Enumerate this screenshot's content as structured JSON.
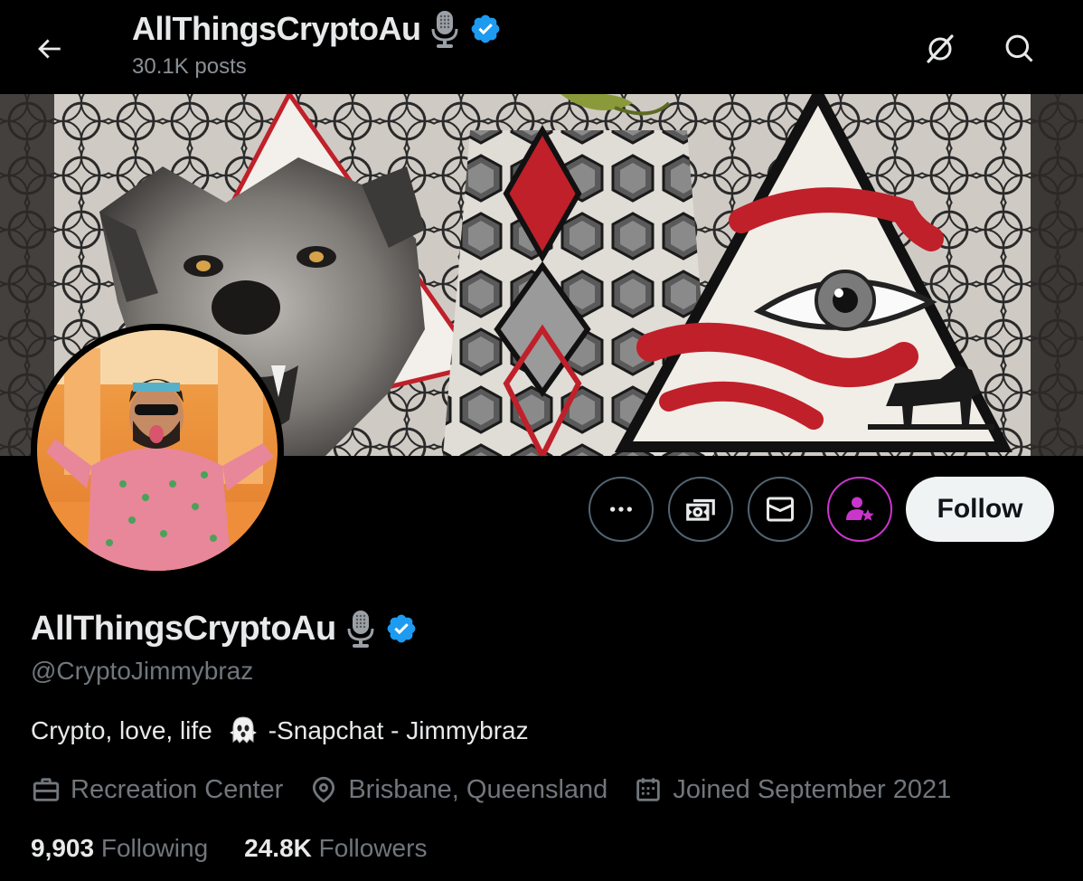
{
  "header": {
    "title": "AllThingsCryptoAu",
    "posts_count": "30.1K posts"
  },
  "profile": {
    "display_name": "AllThingsCryptoAu",
    "handle": "@CryptoJimmybraz",
    "bio_text_1": "Crypto, love, life",
    "bio_text_2": "-Snapchat - Jimmybraz",
    "category": "Recreation Center",
    "location": "Brisbane, Queensland",
    "joined": "Joined September 2021",
    "following_count": "9,903",
    "following_label": "Following",
    "followers_count": "24.8K",
    "followers_label": "Followers"
  },
  "actions": {
    "follow_label": "Follow"
  },
  "colors": {
    "background": "#000000",
    "verified": "#1d9bf0",
    "subscribe_accent": "#c936cc",
    "follow_button_bg": "#eff3f4",
    "muted_text": "#71767b"
  },
  "icons": {
    "back": "arrow-left-icon",
    "grok": "grok-icon",
    "search": "search-icon",
    "more": "more-icon",
    "tip": "money-icon",
    "message": "mail-icon",
    "subscribe": "person-star-icon",
    "category": "briefcase-icon",
    "location": "location-pin-icon",
    "joined": "calendar-icon",
    "badge": "microphone-icon",
    "verified": "verified-badge-icon",
    "bio_emoji": "ghost-icon"
  }
}
